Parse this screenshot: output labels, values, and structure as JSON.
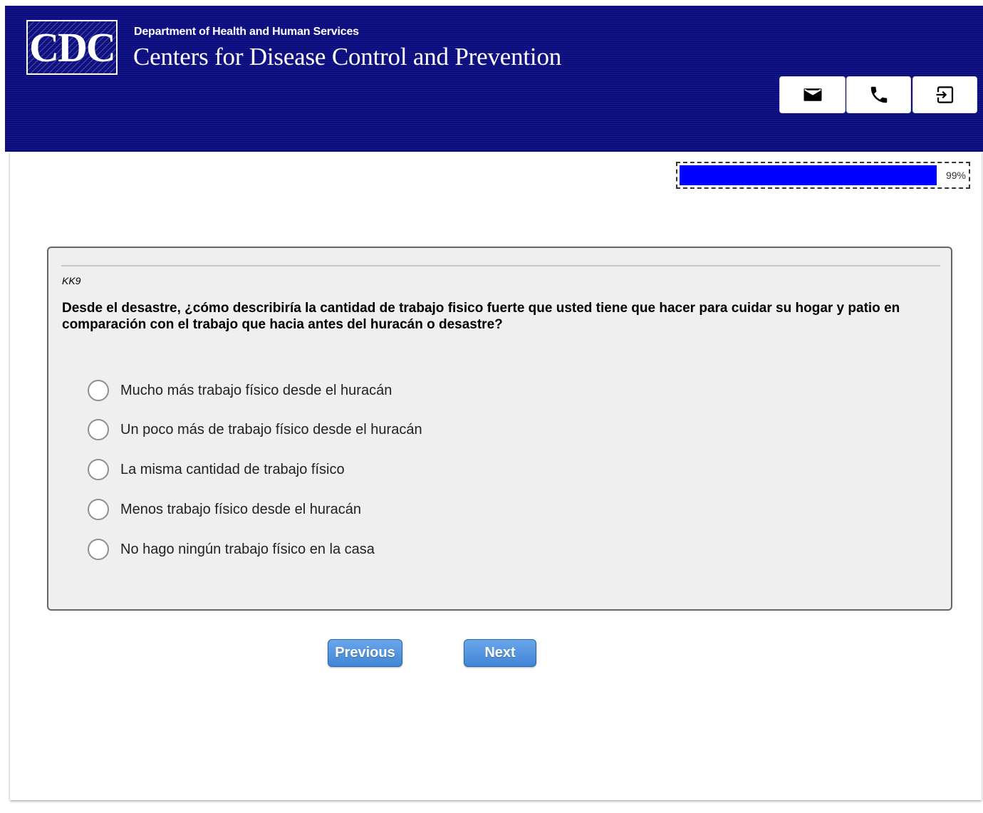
{
  "header": {
    "logo_text": "CDC",
    "department": "Department of Health and Human Services",
    "agency": "Centers for Disease Control and Prevention",
    "background_color": "#0b0d7f",
    "buttons": [
      {
        "icon": "mail-icon",
        "name": "email"
      },
      {
        "icon": "phone-icon",
        "name": "phone"
      },
      {
        "icon": "exit-icon",
        "name": "exit"
      }
    ]
  },
  "progress": {
    "label": "99%",
    "value": 0.99,
    "fill_color": "#0000ff"
  },
  "question": {
    "id": "KK9",
    "text": "Desde el desastre, ¿cómo describiría la cantidad de trabajo fisico fuerte que usted tiene que hacer para cuidar su hogar y patio en comparación con el trabajo que hacia antes del huracán o desastre?",
    "options": [
      {
        "label": "Mucho más trabajo físico desde el huracán",
        "selected": false
      },
      {
        "label": "Un poco más de trabajo físico desde el huracán",
        "selected": false
      },
      {
        "label": "La misma cantidad de trabajo físico",
        "selected": false
      },
      {
        "label": "Menos trabajo físico desde el huracán",
        "selected": false
      },
      {
        "label": "No hago ningún trabajo físico en la casa",
        "selected": false
      }
    ]
  },
  "nav": {
    "previous_label": "Previous",
    "next_label": "Next",
    "button_color": "#4f93e0"
  }
}
